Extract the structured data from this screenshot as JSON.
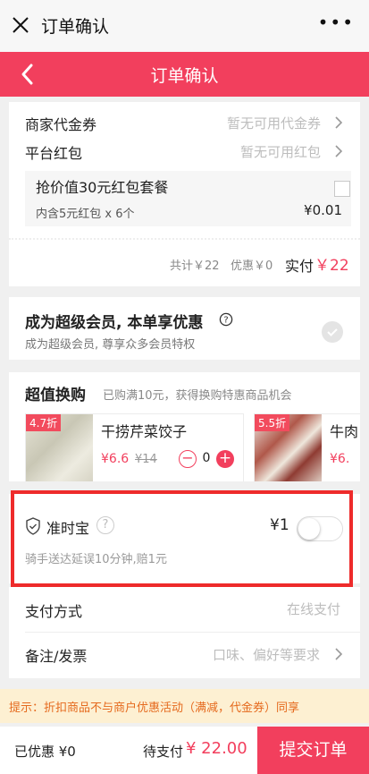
{
  "wx": {
    "title": "订单确认",
    "more": "•••"
  },
  "header": {
    "title": "订单确认"
  },
  "discounts": {
    "merchant_label": "商家代金券",
    "merchant_value": "暂无可用代金券",
    "platform_label": "平台红包",
    "platform_value": "暂无可用红包",
    "package_title": "抢价值30元红包套餐",
    "package_desc": "内含5元红包 x 6个",
    "package_price": "¥0.01"
  },
  "summary": {
    "total": "共计￥22",
    "discount": "优惠￥0",
    "paid_label": "实付",
    "paid_value": "￥22"
  },
  "vip": {
    "title": "成为超级会员, 本单享优惠",
    "subtitle": "成为超级会员, 尊享众多会员特权",
    "help_icon": "question-circle-icon"
  },
  "exchange": {
    "title": "超值换购",
    "subtitle": "已购满10元，获得换购特惠商品机会",
    "products": [
      {
        "discount": "4.7折",
        "name": "干捞芹菜饺子",
        "price": "¥6.6",
        "old_price": "¥14",
        "qty": "0"
      },
      {
        "discount": "5.5折",
        "name": "牛肉",
        "price": "¥6.",
        "old_price": ""
      }
    ]
  },
  "insurance": {
    "title": "准时宝",
    "help": "?",
    "price": "¥1",
    "desc": "骑手送达延误10分钟,赔1元",
    "enabled": false
  },
  "payment": {
    "label": "支付方式",
    "value": "在线支付"
  },
  "remarks": {
    "label": "备注/发票",
    "placeholder": "口味、偏好等要求"
  },
  "tip": "提示：折扣商品不与商户优惠活动（满减，代金券）同享",
  "footer": {
    "saved": "已优惠 ¥0",
    "to_pay_label": "待支付",
    "to_pay_value": "¥ 22.00",
    "submit": "提交订单"
  },
  "colors": {
    "brand": "#f23f5d",
    "tip_text": "#e56a1e",
    "tip_bg": "#fdf0d2",
    "highlight_box": "#ee2b2b"
  }
}
